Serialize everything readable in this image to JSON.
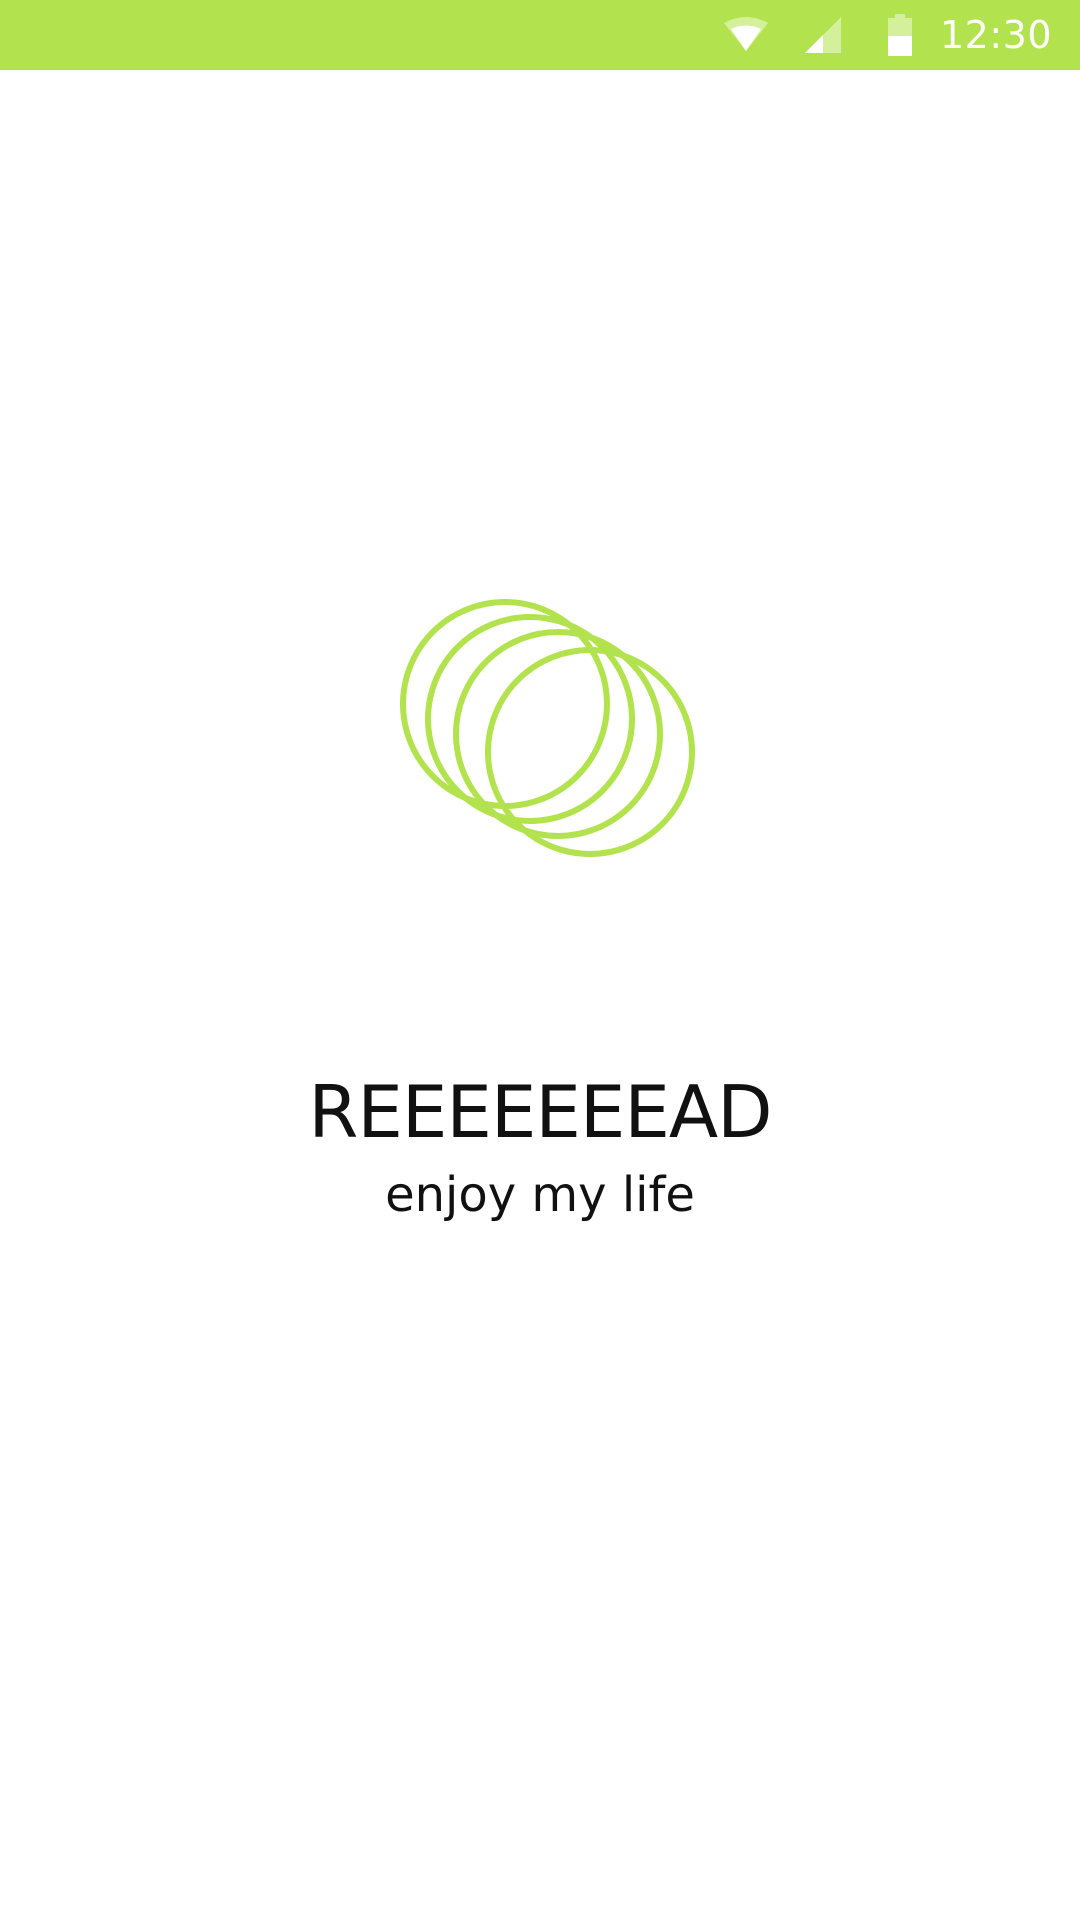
{
  "status_bar": {
    "time": "12:30",
    "icons": [
      "wifi-icon",
      "cellular-signal-icon",
      "battery-icon"
    ],
    "background_color": "#b2e34e"
  },
  "splash": {
    "logo_icon": "rings-logo-icon",
    "accent_color": "#b2e34e",
    "title": "REEEEEEEAD",
    "tagline": "enjoy my life"
  }
}
